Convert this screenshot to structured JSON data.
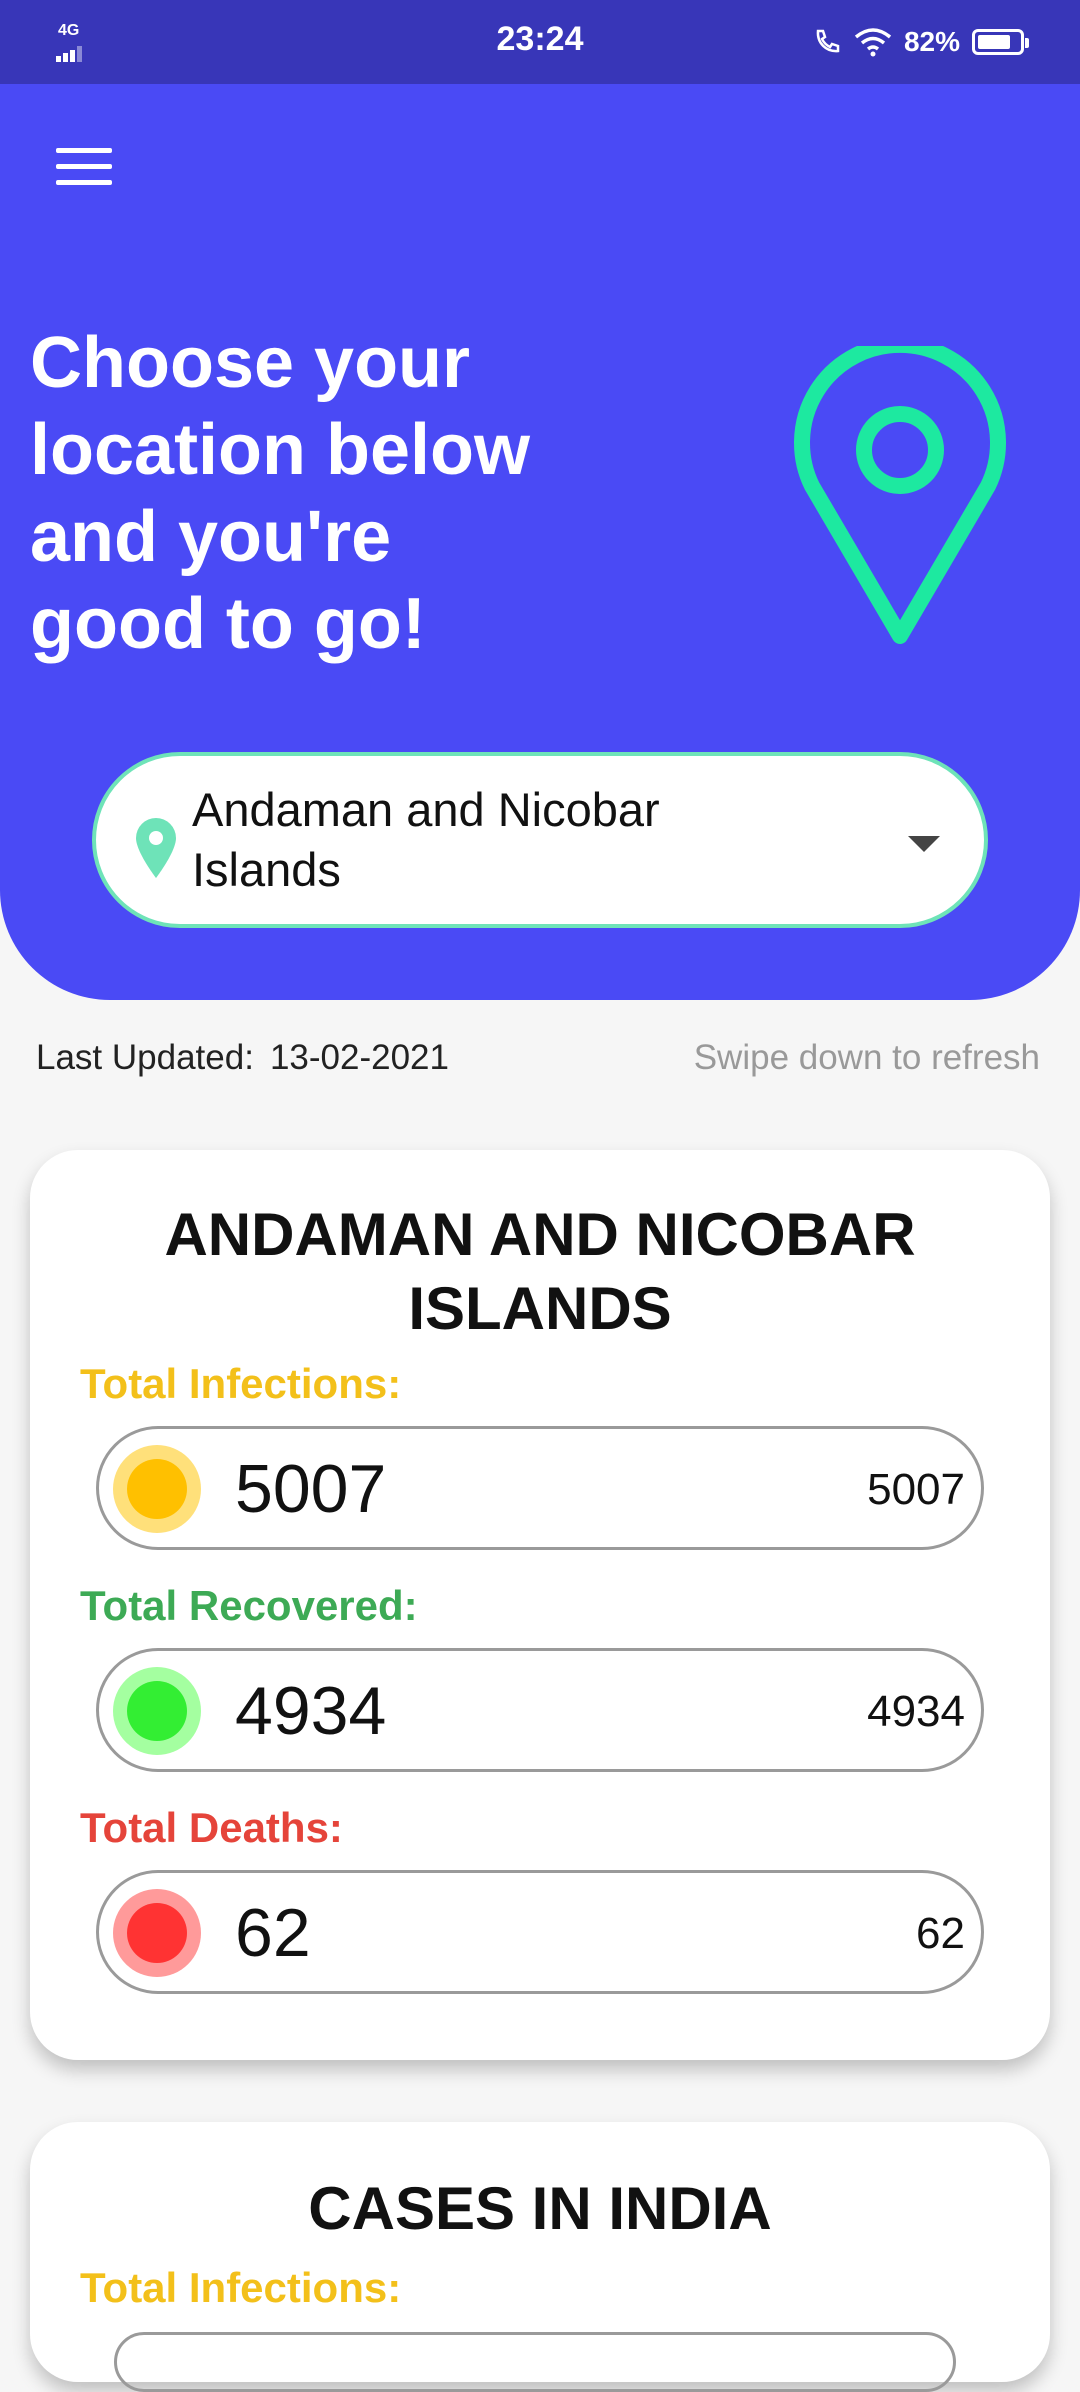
{
  "status_bar": {
    "time": "23:24",
    "network": "4G",
    "battery": "82%"
  },
  "header": {
    "headline_lines": [
      "Choose your",
      "location below",
      "and you're",
      "good to go!"
    ],
    "selected_location_lines": [
      "Andaman and Nicobar",
      "Islands"
    ],
    "accent_color": "#4a4af5",
    "pin_color": "#1de9a0"
  },
  "update": {
    "label": "Last Updated:",
    "date": "13-02-2021",
    "hint": "Swipe down to refresh"
  },
  "region_card": {
    "title_lines": [
      "ANDAMAN AND NICOBAR",
      "ISLANDS"
    ],
    "infections_label": "Total Infections:",
    "infections_value": "5007",
    "infections_count": "5007",
    "recovered_label": "Total Recovered:",
    "recovered_value": "4934",
    "recovered_count": "4934",
    "deaths_label": "Total Deaths:",
    "deaths_value": "62",
    "deaths_count": "62"
  },
  "india_card": {
    "title": "CASES IN INDIA",
    "infections_label": "Total Infections:"
  }
}
